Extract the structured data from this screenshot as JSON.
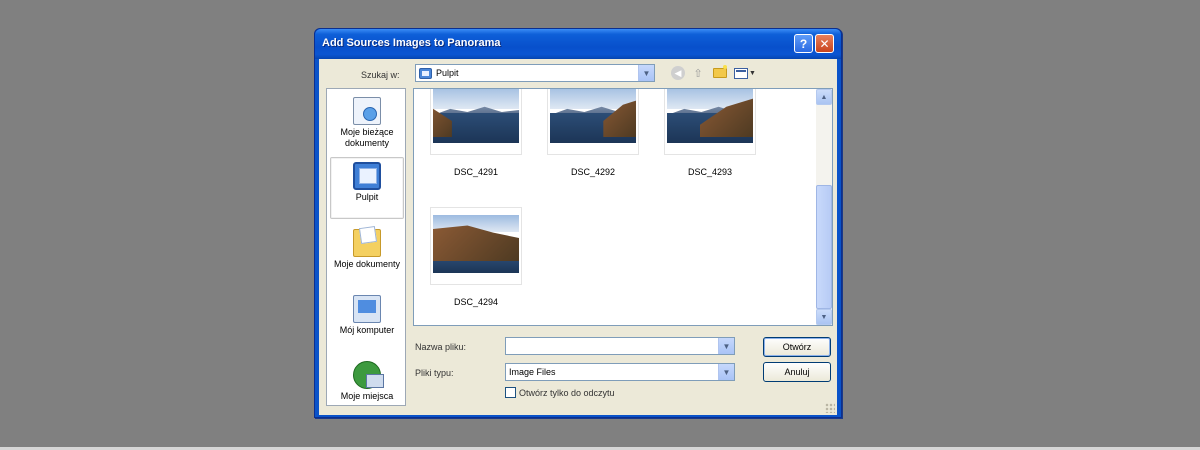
{
  "dialog": {
    "title": "Add Sources Images to Panorama",
    "help_label": "?",
    "close_label": "✕"
  },
  "toolbar": {
    "lookin_label": "Szukaj w:",
    "lookin_value": "Pulpit",
    "icons": [
      "back-icon",
      "up-folder-icon",
      "new-folder-icon",
      "views-menu-icon"
    ]
  },
  "places": [
    {
      "label": "Moje bieżące\ndokumenty",
      "icon": "recent-documents-icon"
    },
    {
      "label": "Pulpit",
      "icon": "desktop-icon",
      "selected": true
    },
    {
      "label": "Moje dokumenty",
      "icon": "my-documents-icon"
    },
    {
      "label": "Mój komputer",
      "icon": "my-computer-icon"
    },
    {
      "label": "Moje miejsca",
      "icon": "network-places-icon"
    }
  ],
  "files": [
    {
      "name": "DSC_4291"
    },
    {
      "name": "DSC_4292"
    },
    {
      "name": "DSC_4293"
    },
    {
      "name": "DSC_4294"
    }
  ],
  "form": {
    "filename_label": "Nazwa pliku:",
    "filename_value": "",
    "filetype_label": "Pliki typu:",
    "filetype_value": "Image Files",
    "readonly_label": "Otwórz tylko do odczytu",
    "readonly_checked": false
  },
  "buttons": {
    "open": "Otwórz",
    "cancel": "Anuluj"
  }
}
